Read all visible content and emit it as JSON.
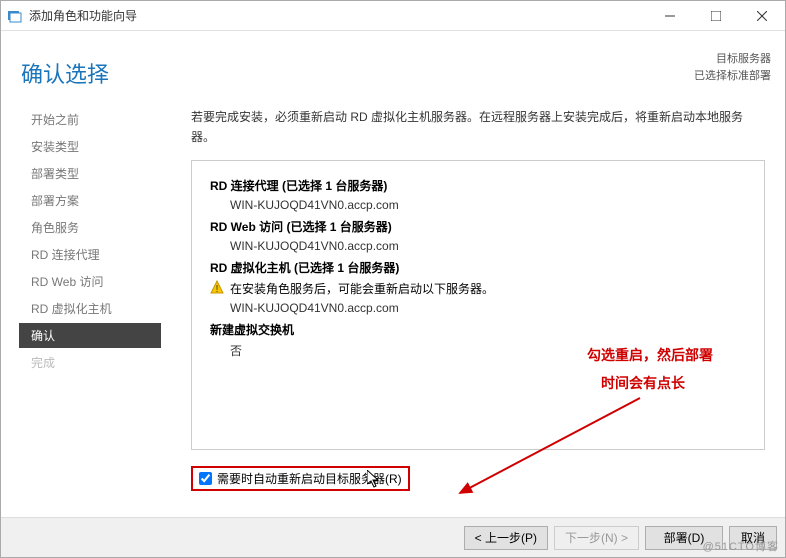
{
  "titlebar": {
    "title": "添加角色和功能向导"
  },
  "page_title": "确认选择",
  "dest": {
    "label": "目标服务器",
    "value": "已选择标准部署"
  },
  "sidebar": {
    "items": [
      {
        "label": "开始之前"
      },
      {
        "label": "安装类型"
      },
      {
        "label": "部署类型"
      },
      {
        "label": "部署方案"
      },
      {
        "label": "角色服务"
      },
      {
        "label": "RD 连接代理"
      },
      {
        "label": "RD Web 访问"
      },
      {
        "label": "RD 虚拟化主机"
      },
      {
        "label": "确认"
      },
      {
        "label": "完成"
      }
    ]
  },
  "intro": "若要完成安装，必须重新启动 RD 虚拟化主机服务器。在远程服务器上安装完成后，将重新启动本地服务器。",
  "roles": {
    "r1": {
      "title": "RD 连接代理  (已选择 1 台服务器)",
      "server": "WIN-KUJOQD41VN0.accp.com"
    },
    "r2": {
      "title": "RD Web 访问  (已选择 1 台服务器)",
      "server": "WIN-KUJOQD41VN0.accp.com"
    },
    "r3": {
      "title": "RD 虚拟化主机  (已选择 1 台服务器)",
      "warn": "在安装角色服务后，可能会重新启动以下服务器。",
      "server": "WIN-KUJOQD41VN0.accp.com"
    },
    "vswitch_title": "新建虚拟交换机",
    "vswitch_value": "否"
  },
  "checkbox": {
    "label": "需要时自动重新启动目标服务器(R)"
  },
  "annotation": {
    "line1": "勾选重启，然后部署",
    "line2": "时间会有点长"
  },
  "buttons": {
    "prev": "< 上一步(P)",
    "next": "下一步(N) >",
    "deploy": "部署(D)",
    "cancel": "取消"
  },
  "watermark": "@51CTO博客"
}
